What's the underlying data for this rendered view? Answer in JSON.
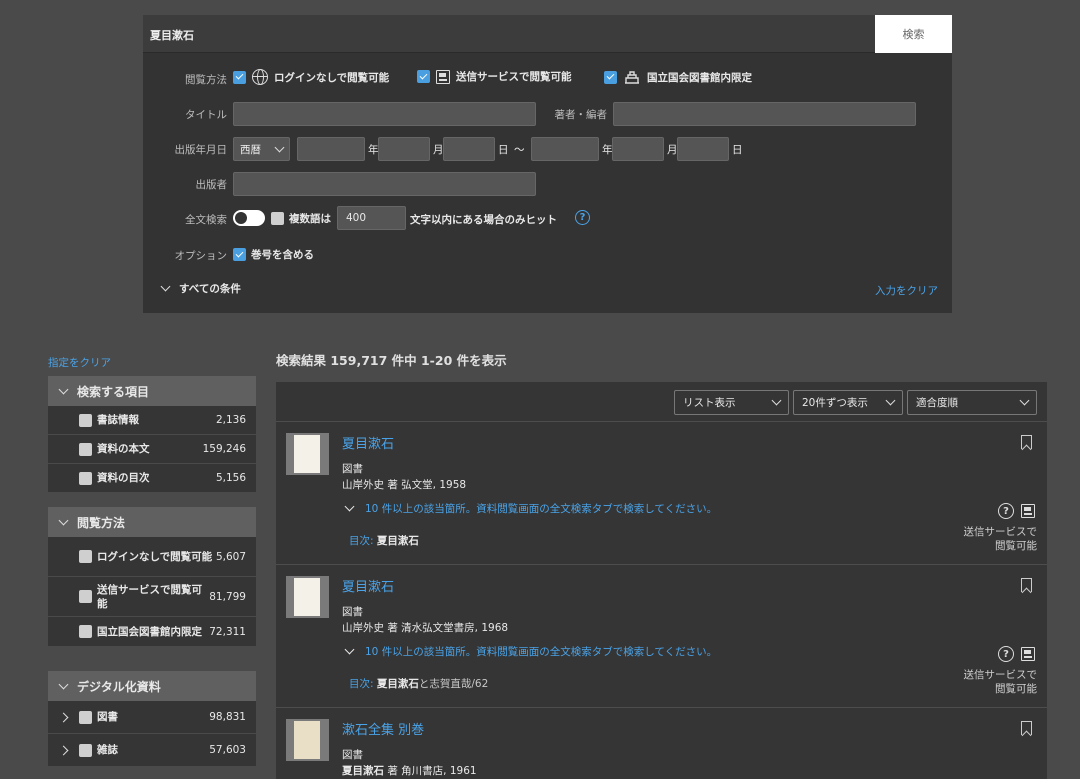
{
  "search": {
    "query": "夏目漱石",
    "button": "検索"
  },
  "filters": {
    "access_label": "閲覧方法",
    "access_options": [
      {
        "label": "ログインなしで閲覧可能",
        "icon": "globe-icon",
        "checked": true
      },
      {
        "label": "送信サービスで閲覧可能",
        "icon": "send-service-icon",
        "checked": true
      },
      {
        "label": "国立国会図書館内限定",
        "icon": "library-icon",
        "checked": true
      }
    ],
    "title_label": "タイトル",
    "author_label": "著者・編者",
    "date_label": "出版年月日",
    "era": "西暦",
    "year_unit": "年",
    "month_unit": "月",
    "day_unit": "日",
    "range_sep": "～",
    "publisher_label": "出版者",
    "fulltext_label": "全文検索",
    "multiword_label": "複数語は",
    "multiword_value": "400",
    "multiword_suffix": "文字以内にある場合のみヒット",
    "option_label": "オプション",
    "option_text": "巻号を含める",
    "all_conditions": "すべての条件",
    "clear_input": "入力をクリア"
  },
  "sidebar": {
    "clear": "指定をクリア",
    "facets": [
      {
        "title": "検索する項目",
        "items": [
          {
            "label": "書誌情報",
            "count": "2,136"
          },
          {
            "label": "資料の本文",
            "count": "159,246"
          },
          {
            "label": "資料の目次",
            "count": "5,156"
          }
        ]
      },
      {
        "title": "閲覧方法",
        "items": [
          {
            "label": "ログインなしで閲覧可能",
            "count": "5,607"
          },
          {
            "label": "送信サービスで閲覧可能",
            "count": "81,799"
          },
          {
            "label": "国立国会図書館内限定",
            "count": "72,311"
          }
        ]
      },
      {
        "title": "デジタル化資料",
        "items": [
          {
            "label": "図書",
            "count": "98,831"
          },
          {
            "label": "雑誌",
            "count": "57,603"
          }
        ]
      }
    ]
  },
  "results": {
    "summary": "検索結果 159,717 件中 1-20 件を表示",
    "view_mode": "リスト表示",
    "per_page": "20件ずつ表示",
    "sort": "適合度順",
    "records": [
      {
        "title": "夏目漱石",
        "type": "図書",
        "author_line": "山岸外史 著 弘文堂, 1958",
        "hits": "10 件以上の該当箇所。資料閲覧画面の全文検索タブで検索してください。",
        "toc_label": "目次:",
        "toc_bold": "夏目漱石",
        "toc_rest": "",
        "status_1": "送信サービスで",
        "status_2": "閲覧可能"
      },
      {
        "title": "夏目漱石",
        "type": "図書",
        "author_line": "山岸外史 著 清水弘文堂書房, 1968",
        "hits": "10 件以上の該当箇所。資料閲覧画面の全文検索タブで検索してください。",
        "toc_label": "目次:",
        "toc_bold": "夏目漱石",
        "toc_rest": "と志賀直哉/62",
        "status_1": "送信サービスで",
        "status_2": "閲覧可能"
      },
      {
        "title": "漱石全集 別巻",
        "type": "図書",
        "author_bold": "夏目漱石",
        "author_line": "著 角川書店, 1961"
      }
    ]
  },
  "colors": {
    "accent": "#4aa3e8",
    "background": "#4a4a4a",
    "panel": "#333333"
  }
}
